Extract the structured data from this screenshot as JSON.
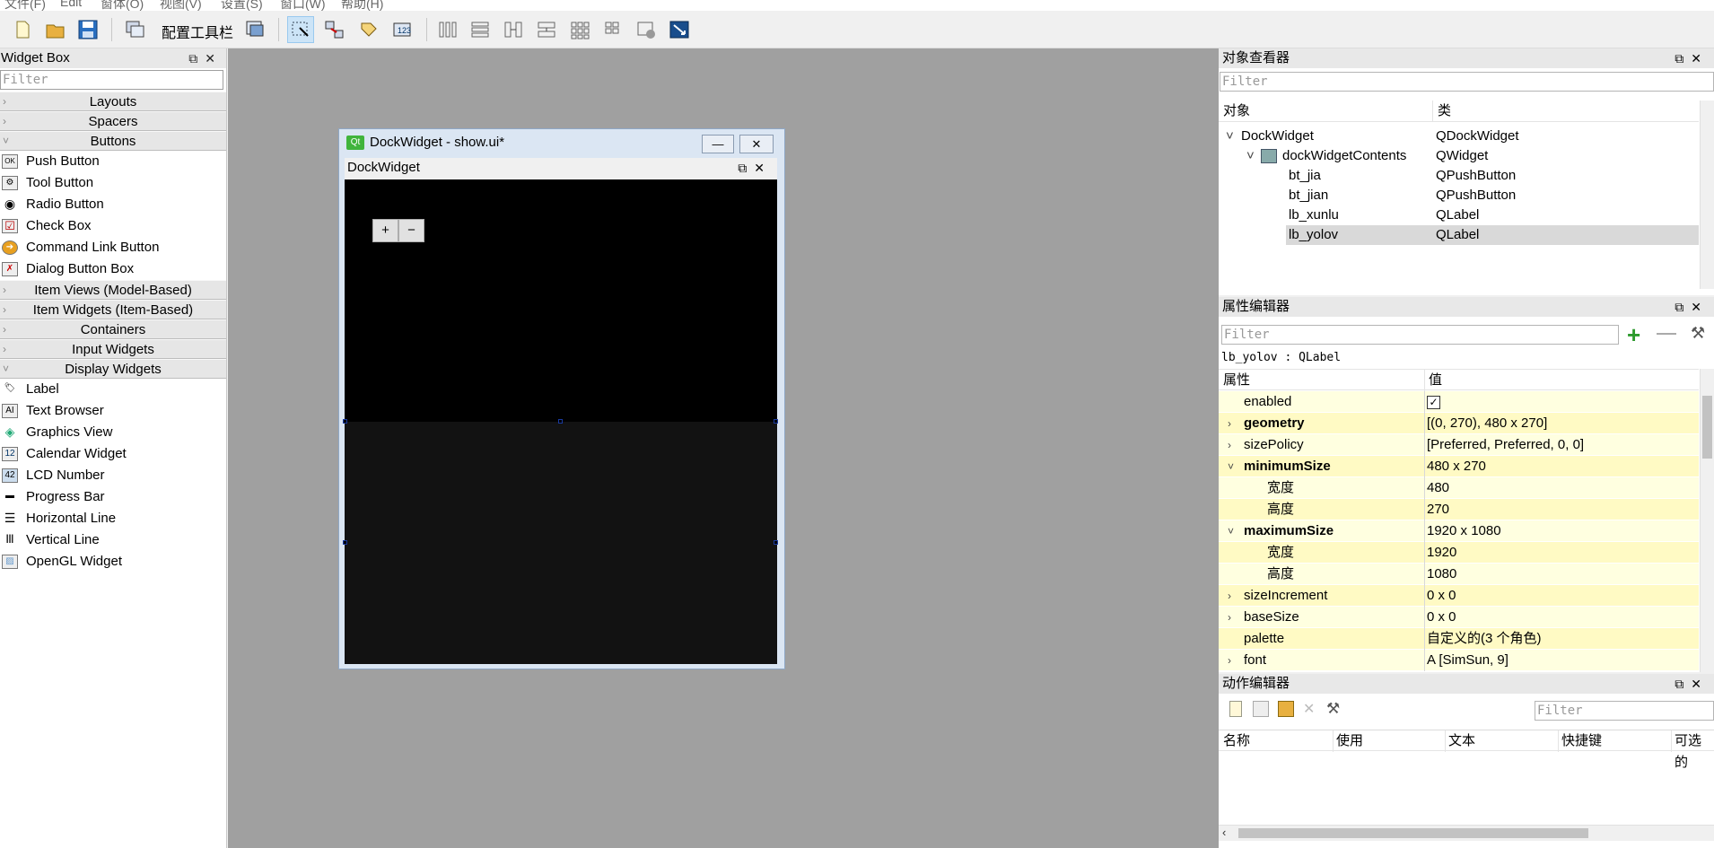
{
  "menu": [
    "文件(F)",
    "Edit",
    "窗体(O)",
    "视图(V)",
    "设置(S)",
    "窗口(W)",
    "帮助(H)"
  ],
  "toolbar": {
    "config_label": "配置工具栏"
  },
  "widget_box": {
    "title": "Widget Box",
    "filter_placeholder": "Filter",
    "categories_top": [
      "Layouts",
      "Spacers",
      "Buttons"
    ],
    "buttons": [
      {
        "label": "Push Button",
        "icon": "OK"
      },
      {
        "label": "Tool Button",
        "icon": "⚙"
      },
      {
        "label": "Radio Button",
        "icon": "◉"
      },
      {
        "label": "Check Box",
        "icon": "☑"
      },
      {
        "label": "Command Link Button",
        "icon": "➔"
      },
      {
        "label": "Dialog Button Box",
        "icon": "✗"
      }
    ],
    "categories_mid": [
      "Item Views (Model-Based)",
      "Item Widgets (Item-Based)",
      "Containers",
      "Input Widgets",
      "Display Widgets"
    ],
    "display": [
      {
        "label": "Label",
        "icon": "🏷"
      },
      {
        "label": "Text Browser",
        "icon": "AI"
      },
      {
        "label": "Graphics View",
        "icon": "◈"
      },
      {
        "label": "Calendar Widget",
        "icon": "12"
      },
      {
        "label": "LCD Number",
        "icon": "42"
      },
      {
        "label": "Progress Bar",
        "icon": "▬"
      },
      {
        "label": "Horizontal Line",
        "icon": "☰"
      },
      {
        "label": "Vertical Line",
        "icon": "|||"
      },
      {
        "label": "OpenGL Widget",
        "icon": "▨"
      }
    ]
  },
  "form": {
    "title": "DockWidget - show.ui*",
    "dock_title": "DockWidget",
    "btn_plus": "+",
    "btn_minus": "−"
  },
  "object_inspector": {
    "title": "对象查看器",
    "filter_placeholder": "Filter",
    "col_object": "对象",
    "col_class": "类",
    "rows": [
      {
        "name": "DockWidget",
        "cls": "QDockWidget"
      },
      {
        "name": "dockWidgetContents",
        "cls": "QWidget"
      },
      {
        "name": "bt_jia",
        "cls": "QPushButton"
      },
      {
        "name": "bt_jian",
        "cls": "QPushButton"
      },
      {
        "name": "lb_xunlu",
        "cls": "QLabel"
      },
      {
        "name": "lb_yolov",
        "cls": "QLabel"
      }
    ]
  },
  "property_editor": {
    "title": "属性编辑器",
    "filter_placeholder": "Filter",
    "object_line": "lb_yolov : QLabel",
    "col_prop": "属性",
    "col_value": "值",
    "rows": [
      {
        "name": "enabled",
        "value": "✓"
      },
      {
        "name": "geometry",
        "value": "[(0, 270), 480 x 270]"
      },
      {
        "name": "sizePolicy",
        "value": "[Preferred, Preferred, 0, 0]"
      },
      {
        "name": "minimumSize",
        "value": "480 x 270"
      },
      {
        "name": "宽度",
        "value": "480"
      },
      {
        "name": "高度",
        "value": "270"
      },
      {
        "name": "maximumSize",
        "value": "1920 x 1080"
      },
      {
        "name": "宽度",
        "value": "1920"
      },
      {
        "name": "高度",
        "value": "1080"
      },
      {
        "name": "sizeIncrement",
        "value": "0 x 0"
      },
      {
        "name": "baseSize",
        "value": "0 x 0"
      },
      {
        "name": "palette",
        "value": "自定义的(3 个角色)"
      },
      {
        "name": "font",
        "value": "A  [SimSun, 9]"
      }
    ]
  },
  "action_editor": {
    "title": "动作编辑器",
    "filter_placeholder": "Filter",
    "columns": [
      "名称",
      "使用",
      "文本",
      "快捷键",
      "可选的"
    ]
  }
}
